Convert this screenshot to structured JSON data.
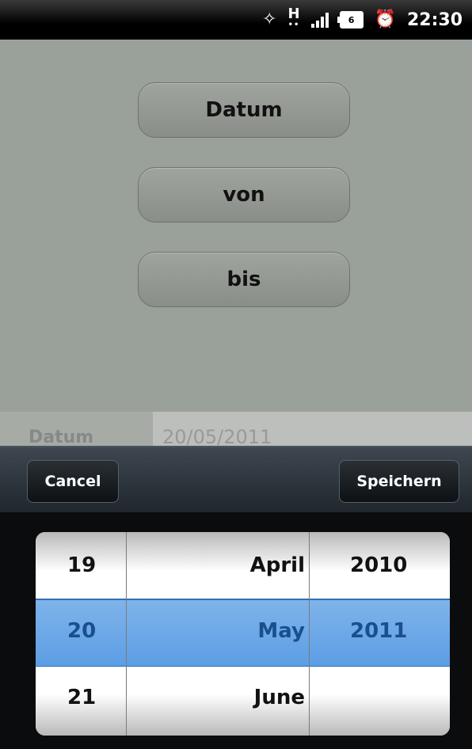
{
  "status_bar": {
    "battery_level": "6",
    "network_type": "H",
    "time": "22:30"
  },
  "buttons": {
    "datum": "Datum",
    "von": "von",
    "bis": "bis"
  },
  "field": {
    "label": "Datum",
    "value": "20/05/2011"
  },
  "dialog": {
    "cancel_label": "Cancel",
    "save_label": "Speichern"
  },
  "picker": {
    "rows": [
      {
        "day": "19",
        "month": "April",
        "year": "2010"
      },
      {
        "day": "20",
        "month": "May",
        "year": "2011"
      },
      {
        "day": "21",
        "month": "June",
        "year": ""
      }
    ],
    "selected_index": 1
  }
}
